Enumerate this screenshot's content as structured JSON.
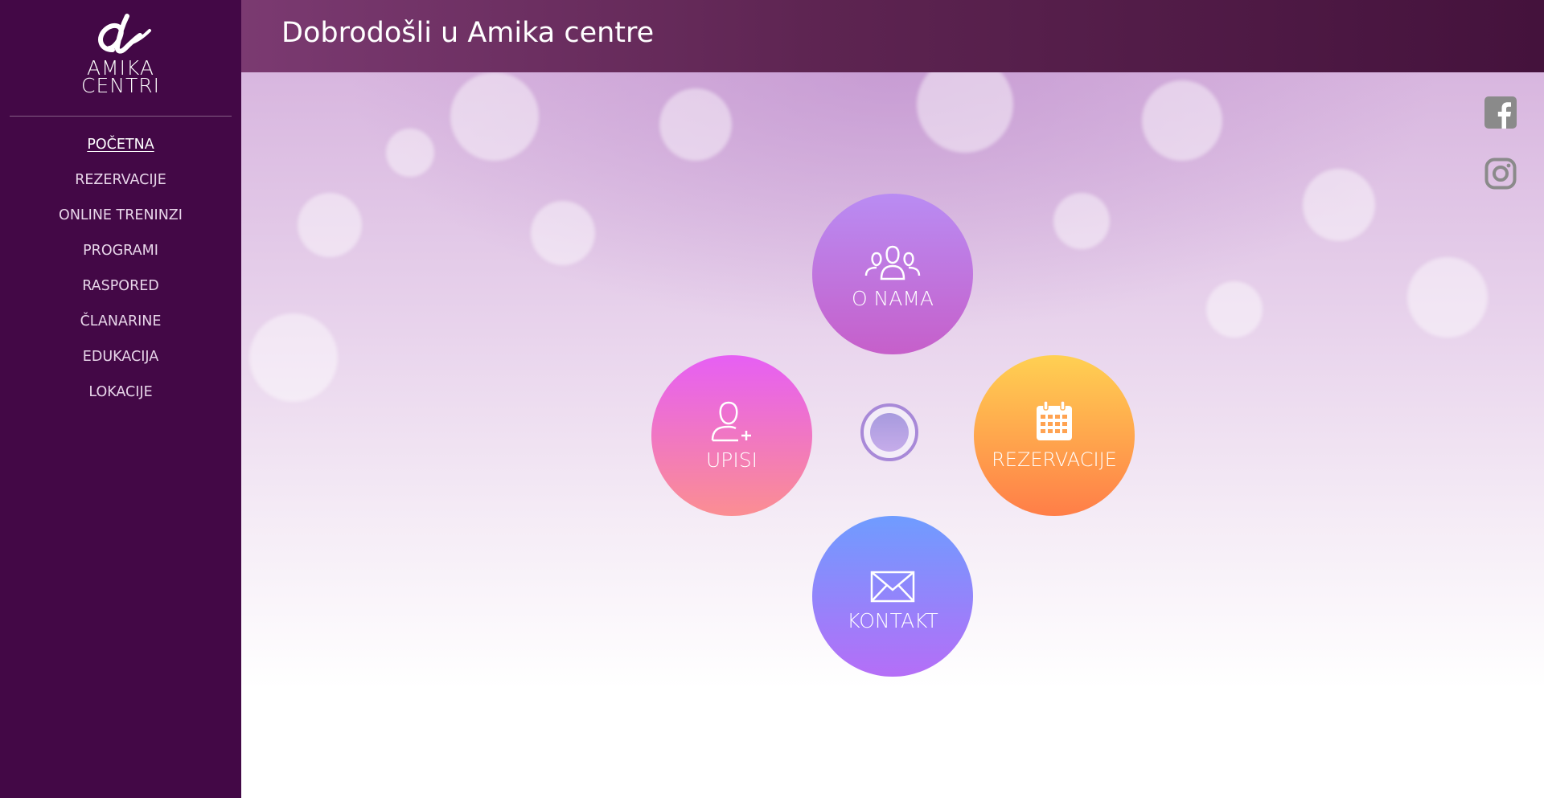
{
  "sidebar": {
    "logo": {
      "line1": "AMIKA",
      "line2": "CENTRI"
    },
    "nav": [
      {
        "label": "POČETNA",
        "active": true
      },
      {
        "label": "REZERVACIJE"
      },
      {
        "label": "ONLINE TRENINZI"
      },
      {
        "label": "PROGRAMI"
      },
      {
        "label": "RASPORED"
      },
      {
        "label": "ČLANARINE"
      },
      {
        "label": "EDUKACIJA"
      },
      {
        "label": "LOKACIJE"
      }
    ]
  },
  "header": {
    "title": "Dobrodošli u Amika centre"
  },
  "social": {
    "icons": [
      "facebook-icon",
      "instagram-icon"
    ]
  },
  "hub": {
    "items": [
      {
        "label": "O NAMA",
        "icon": "group-icon"
      },
      {
        "label": "UPISI",
        "icon": "add-user-icon"
      },
      {
        "label": "REZERVACIJE",
        "icon": "calendar-icon"
      },
      {
        "label": "KONTAKT",
        "icon": "envelope-icon"
      }
    ]
  },
  "colors": {
    "sidebar": "#430846",
    "header_start": "#7b3a71",
    "header_end": "#44123c"
  }
}
